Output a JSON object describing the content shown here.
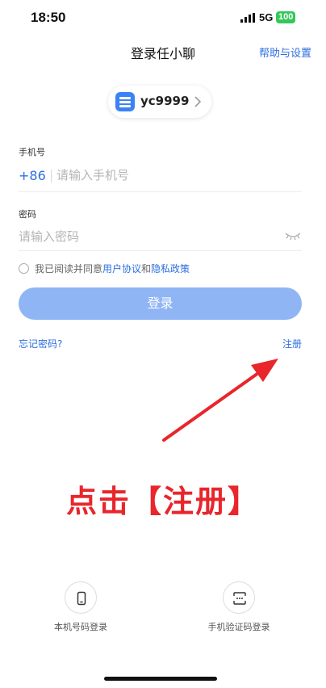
{
  "status_bar": {
    "time": "18:50",
    "network": "5G",
    "battery": "100"
  },
  "nav": {
    "title": "登录任小聊",
    "help_label": "帮助与设置"
  },
  "account": {
    "name": "yc9999"
  },
  "phone": {
    "label": "手机号",
    "prefix": "+86",
    "placeholder": "请输入手机号"
  },
  "password": {
    "label": "密码",
    "placeholder": "请输入密码"
  },
  "agreement": {
    "prefix": "我已阅读并同意",
    "user_agreement": "用户协议",
    "and": "和",
    "privacy_policy": "隐私政策"
  },
  "login_button": "登录",
  "forgot_password": "忘记密码?",
  "register": "注册",
  "annotation": {
    "text": "点击【注册】",
    "color": "#e8262b"
  },
  "alt_login": [
    {
      "label": "本机号码登录",
      "icon": "mobile-phone-icon"
    },
    {
      "label": "手机验证码登录",
      "icon": "sms-code-icon"
    }
  ],
  "colors": {
    "accent": "#2d6fe0",
    "button": "#8fb5f5",
    "battery": "#34c759"
  }
}
